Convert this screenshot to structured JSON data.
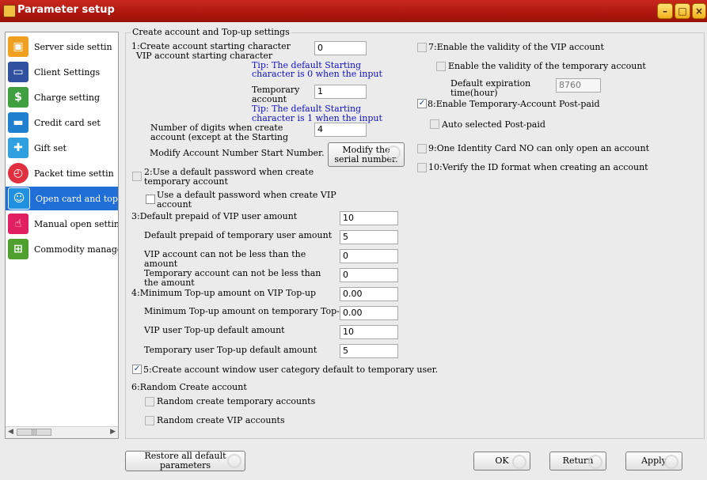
{
  "window": {
    "title": "Parameter setup"
  },
  "sidebar": {
    "items": [
      {
        "label": "Server side settin",
        "icon": "server-icon",
        "color": "#f0a020"
      },
      {
        "label": "Client Settings",
        "icon": "monitor-icon",
        "color": "#3050a0"
      },
      {
        "label": "Charge setting",
        "icon": "charge-icon",
        "color": "#40a040"
      },
      {
        "label": "Credit card set",
        "icon": "credit-card-icon",
        "color": "#2080d0"
      },
      {
        "label": "Gift set",
        "icon": "gift-icon",
        "color": "#30a0e0"
      },
      {
        "label": "Packet time settin",
        "icon": "clock-icon",
        "color": "#e03040"
      },
      {
        "label": "Open card and top",
        "icon": "id-card-icon",
        "color": "#2090e0"
      },
      {
        "label": "Manual open settin",
        "icon": "hand-icon",
        "color": "#e02060"
      },
      {
        "label": "Commodity manageme",
        "icon": "cart-icon",
        "color": "#50a030"
      }
    ],
    "selected_index": 6,
    "scrollbar": {
      "thumb": "|||"
    }
  },
  "group": {
    "title": "Create account and Top-up settings"
  },
  "left": {
    "s1_label": "1:Create account starting character",
    "vip_start_label": "VIP account starting character",
    "vip_start_value": "0",
    "tip1_line1": "Tip: The default Starting",
    "tip1_line2": "character is 0 when the input",
    "temp_label_l1": "Temporary",
    "temp_label_l2": "account",
    "temp_value": "1",
    "tip2_line1": "Tip: The default Starting",
    "tip2_line2": "character is 1 when the input",
    "digits_l1": "Number of digits when create",
    "digits_l2": "account (except at the Starting",
    "digits_value": "4",
    "modify_label": "Modify Account Number Start Number.",
    "modify_btn_l1": "Modify the",
    "modify_btn_l2": "serial number.",
    "s2_l1": "2:Use a default password when create",
    "s2_l2": "temporary account",
    "vip_pwd_l1": "Use a default password when create VIP",
    "vip_pwd_l2": "account",
    "s3_label": "3:Default prepaid of VIP user amount",
    "s3_value": "10",
    "temp_prepaid_label": "Default prepaid of temporary user amount",
    "temp_prepaid_value": "5",
    "vip_min_l1": "VIP account can not be less than the",
    "vip_min_l2": "amount",
    "vip_min_value": "0",
    "temp_min_l1": "Temporary account can not be less than",
    "temp_min_l2": "the amount",
    "temp_min_value": "0",
    "s4_label": "4:Minimum Top-up amount on VIP Top-up",
    "s4_value": "0.00",
    "temp_min_topup_label": "Minimum Top-up amount on temporary Top-up",
    "temp_min_topup_value": "0.00",
    "vip_topup_default_label": "VIP user Top-up default amount",
    "vip_topup_default_value": "10",
    "temp_topup_default_label": "Temporary user Top-up default amount",
    "temp_topup_default_value": "5",
    "s5_label": "5:Create account window user category default to temporary user.",
    "s5_checked": true,
    "s6_label": "6:Random Create account",
    "random_temp_label": "Random create temporary accounts",
    "random_vip_label": "Random create VIP accounts"
  },
  "right": {
    "s7_label": "7:Enable the validity of the VIP account",
    "temp_validity_label": "Enable the validity of the temporary account",
    "expiration_l1": "Default expiration",
    "expiration_l2": "time(hour)",
    "expiration_value": "8760",
    "s8_label": "8:Enable Temporary-Account Post-paid",
    "s8_checked": true,
    "auto_postpaid_label": "Auto selected Post-paid",
    "s9_label": "9:One Identity Card NO can only open an account",
    "s10_label": "10:Verify the ID format when creating an account"
  },
  "footer": {
    "restore_l1": "Restore all default",
    "restore_l2": "parameters",
    "ok": "OK",
    "return": "Return",
    "apply": "Apply"
  },
  "check_glyph": "✓",
  "window_buttons": {
    "minimize": "–",
    "maximize": "□",
    "close": "×"
  }
}
